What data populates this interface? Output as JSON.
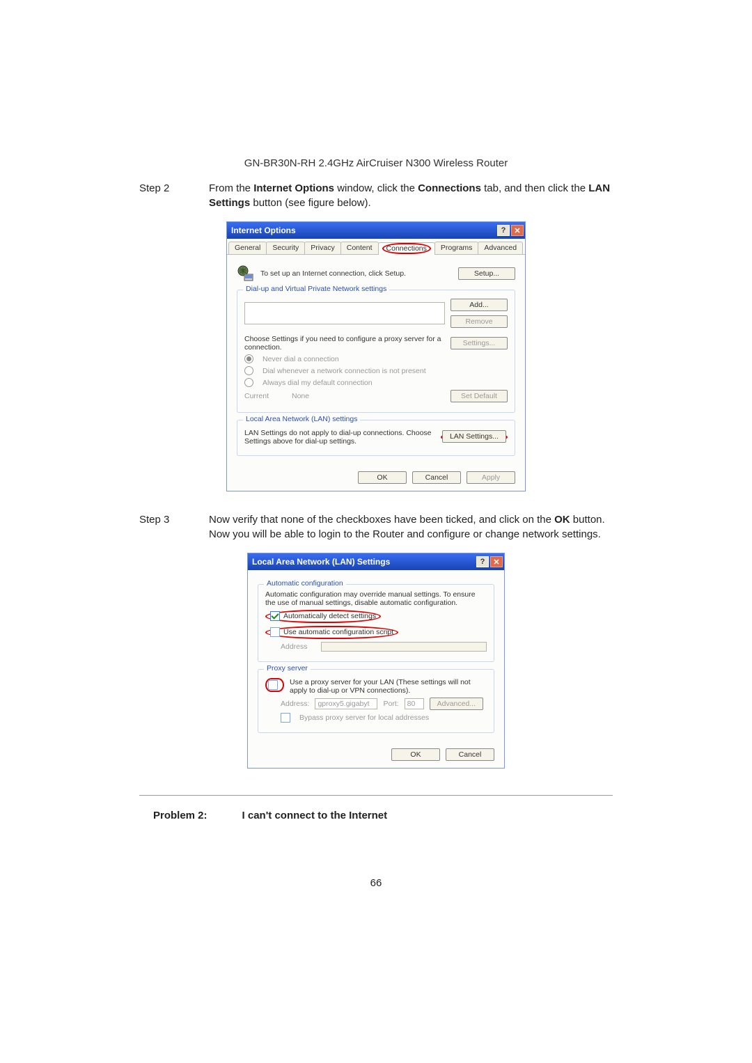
{
  "header": "GN-BR30N-RH  2.4GHz  AirCruiser  N300  Wireless  Router",
  "step2": {
    "label": "Step 2",
    "text_a": "From the ",
    "bold_a": "Internet Options",
    "text_b": " window, click the ",
    "bold_b": "Connections",
    "text_c": " tab, and then click the ",
    "bold_c": "LAN Settings",
    "text_d": " button (see figure below)."
  },
  "io": {
    "title": "Internet Options",
    "tabs": [
      "General",
      "Security",
      "Privacy",
      "Content",
      "Connections",
      "Programs",
      "Advanced"
    ],
    "active_tab": "Connections",
    "setup_text": "To set up an Internet connection, click Setup.",
    "setup_btn": "Setup...",
    "dvp_legend": "Dial-up and Virtual Private Network settings",
    "add_btn": "Add...",
    "remove_btn": "Remove",
    "settings_hint": "Choose Settings if you need to configure a proxy server for a connection.",
    "settings_btn": "Settings...",
    "r1": "Never dial a connection",
    "r2": "Dial whenever a network connection is not present",
    "r3": "Always dial my default connection",
    "current": "Current",
    "none": "None",
    "set_default": "Set Default",
    "lan_legend": "Local Area Network (LAN) settings",
    "lan_hint": "LAN Settings do not apply to dial-up connections. Choose Settings above for dial-up settings.",
    "lan_btn": "LAN Settings...",
    "ok": "OK",
    "cancel": "Cancel",
    "apply": "Apply"
  },
  "step3": {
    "label": "Step 3",
    "text_a": "Now verify that none of the checkboxes have been ticked, and click on the ",
    "bold_a": "OK",
    "text_b": " button.    Now you will be able to login to the Router and configure or change network settings."
  },
  "lan": {
    "title": "Local Area Network (LAN) Settings",
    "auto_legend": "Automatic configuration",
    "auto_hint": "Automatic configuration may override manual settings.  To ensure the use of manual settings, disable automatic configuration.",
    "auto_detect": "Automatically detect settings",
    "auto_script": "Use automatic configuration script",
    "addr_lbl": "Address",
    "proxy_legend": "Proxy server",
    "proxy_chk": "Use a proxy server for your LAN (These settings will not apply to dial-up or VPN connections).",
    "addr2_lbl": "Address:",
    "addr2_val": "gproxy5.gigabyt",
    "port_lbl": "Port:",
    "port_val": "80",
    "adv_btn": "Advanced...",
    "bypass": "Bypass proxy server for local addresses",
    "ok": "OK",
    "cancel": "Cancel"
  },
  "problem": {
    "label": "Problem 2:",
    "title": "I can't connect to the Internet"
  },
  "page_num": "66"
}
